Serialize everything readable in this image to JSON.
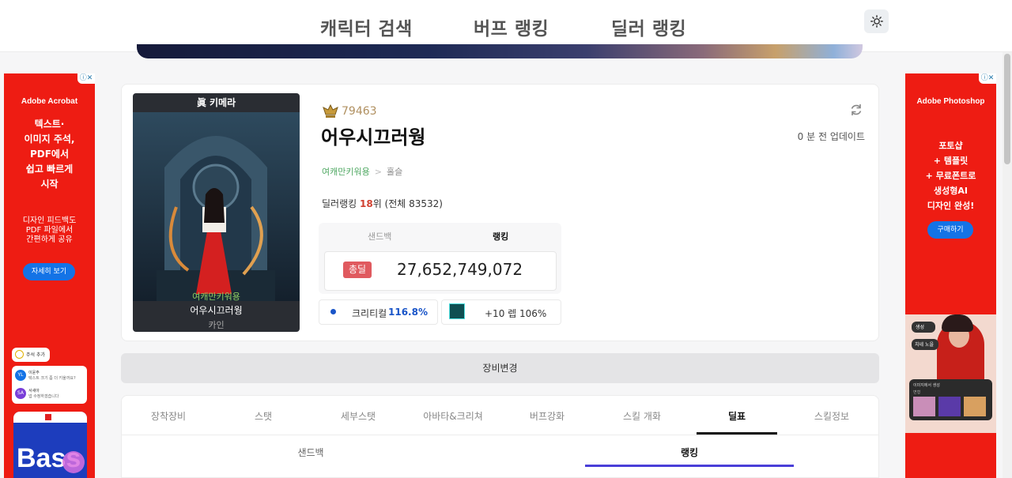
{
  "nav": {
    "items": [
      {
        "label": "캐릭터 검색"
      },
      {
        "label": "버프 랭킹"
      },
      {
        "label": "딜러 랭킹"
      }
    ],
    "theme_icon": "sun-icon"
  },
  "ad_left": {
    "brand": "Adobe Acrobat",
    "headline": [
      "텍스트·",
      "이미지 주석,",
      "PDF에서",
      "쉽고 빠르게",
      "시작"
    ],
    "sub": [
      "디자인 피드백도",
      "PDF 파일에서",
      "간편하게 공유"
    ],
    "button": "자세히 보기",
    "card_chip": "주석 추가",
    "card_rows": [
      {
        "avatar": "YL",
        "name": "이윤주",
        "text": "텍스트 크기 좀 더 키울까요?"
      },
      {
        "avatar": "SA",
        "name": "서새아",
        "text": "넵 수정하겠습니다"
      }
    ],
    "poster_text": "Bass"
  },
  "ad_right": {
    "brand": "Adobe Photoshop",
    "headline": [
      "포토샵",
      "+ 템플릿",
      "+ 무료폰트로",
      "생성형AI",
      "디자인 완성!"
    ],
    "button": "구매하기",
    "chip1": "생성",
    "chip2": "치네 노을",
    "panel_label": "이미지에서 생성",
    "panel_sub": "변형"
  },
  "profile": {
    "char_title": "眞 키메라",
    "char_guild": "여캐만키워용",
    "char_name": "어우시끄러웡",
    "char_class": "카인",
    "fame": "79463",
    "name": "어우시끄러웡",
    "updated": "0 분 전 업데이트",
    "guild": "여캐만키워용",
    "guild_sep": ">",
    "class_label": "홀슬",
    "rank_prefix": "딜러랭킹 ",
    "rank_num": "18",
    "rank_suffix": "위 (전체 83532)",
    "stat_tabs": [
      {
        "label": "샌드백"
      },
      {
        "label": "랭킹"
      }
    ],
    "dmg_badge": "총딜",
    "dmg_value": "27,652,749,072",
    "crit_label": "크리티컬",
    "crit_value": "116.8%",
    "skill_text": "+10 렙 106%"
  },
  "equip_button": "장비변경",
  "tabs": [
    {
      "label": "장착장비"
    },
    {
      "label": "스탯"
    },
    {
      "label": "세부스탯"
    },
    {
      "label": "아바타&크리쳐"
    },
    {
      "label": "버프강화"
    },
    {
      "label": "스킬 개화"
    },
    {
      "label": "딜표"
    },
    {
      "label": "스킬정보"
    }
  ],
  "active_tab": "딜표",
  "subtabs": [
    {
      "label": "샌드백"
    },
    {
      "label": "랭킹"
    }
  ],
  "colors": {
    "accent": "#4a3fd8",
    "damage_badge": "#e05a5f",
    "crit": "#1a55c8",
    "guild": "#4fa862",
    "ad_red": "#ee1c13"
  }
}
